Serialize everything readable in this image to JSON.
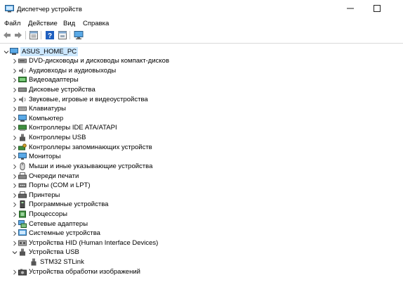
{
  "window": {
    "title": "Диспетчер устройств"
  },
  "menu": [
    "Файл",
    "Действие",
    "Вид",
    "Справка"
  ],
  "toolbar_icons": [
    "back-arrow-icon",
    "forward-arrow-icon",
    "properties-icon",
    "help-icon",
    "show-hidden-icon",
    "monitor-scan-icon"
  ],
  "tree": {
    "root": {
      "label": "ASUS_HOME_PC",
      "icon": "computer-icon",
      "expanded": true
    },
    "categories": [
      {
        "label": "DVD-дисководы и дисководы компакт-дисков",
        "icon": "dvd-drive-icon",
        "expanded": false
      },
      {
        "label": "Аудиовходы и аудиовыходы",
        "icon": "speaker-icon",
        "expanded": false
      },
      {
        "label": "Видеоадаптеры",
        "icon": "display-adapter-icon",
        "expanded": false
      },
      {
        "label": "Дисковые устройства",
        "icon": "disk-drive-icon",
        "expanded": false
      },
      {
        "label": "Звуковые, игровые и видеоустройства",
        "icon": "sound-icon",
        "expanded": false
      },
      {
        "label": "Клавиатуры",
        "icon": "keyboard-icon",
        "expanded": false
      },
      {
        "label": "Компьютер",
        "icon": "monitor-icon",
        "expanded": false
      },
      {
        "label": "Контроллеры IDE ATA/ATAPI",
        "icon": "ide-controller-icon",
        "expanded": false
      },
      {
        "label": "Контроллеры USB",
        "icon": "usb-controller-icon",
        "expanded": false
      },
      {
        "label": "Контроллеры запоминающих устройств",
        "icon": "storage-controller-icon",
        "expanded": false
      },
      {
        "label": "Мониторы",
        "icon": "monitor-icon",
        "expanded": false
      },
      {
        "label": "Мыши и иные указывающие устройства",
        "icon": "mouse-icon",
        "expanded": false
      },
      {
        "label": "Очереди печати",
        "icon": "print-queue-icon",
        "expanded": false
      },
      {
        "label": "Порты (COM и LPT)",
        "icon": "port-icon",
        "expanded": false
      },
      {
        "label": "Принтеры",
        "icon": "printer-icon",
        "expanded": false
      },
      {
        "label": "Программные устройства",
        "icon": "software-device-icon",
        "expanded": false
      },
      {
        "label": "Процессоры",
        "icon": "processor-icon",
        "expanded": false
      },
      {
        "label": "Сетевые адаптеры",
        "icon": "network-adapter-icon",
        "expanded": false
      },
      {
        "label": "Системные устройства",
        "icon": "system-device-icon",
        "expanded": false
      },
      {
        "label": "Устройства HID (Human Interface Devices)",
        "icon": "hid-icon",
        "expanded": false
      },
      {
        "label": "Устройства USB",
        "icon": "usb-device-icon",
        "expanded": true,
        "children": [
          {
            "label": "STM32 STLink",
            "icon": "usb-plug-icon"
          }
        ]
      },
      {
        "label": "Устройства обработки изображений",
        "icon": "camera-icon",
        "expanded": false
      }
    ]
  },
  "colors": {
    "selection": "#cce8ff",
    "separator": "#dadada"
  }
}
